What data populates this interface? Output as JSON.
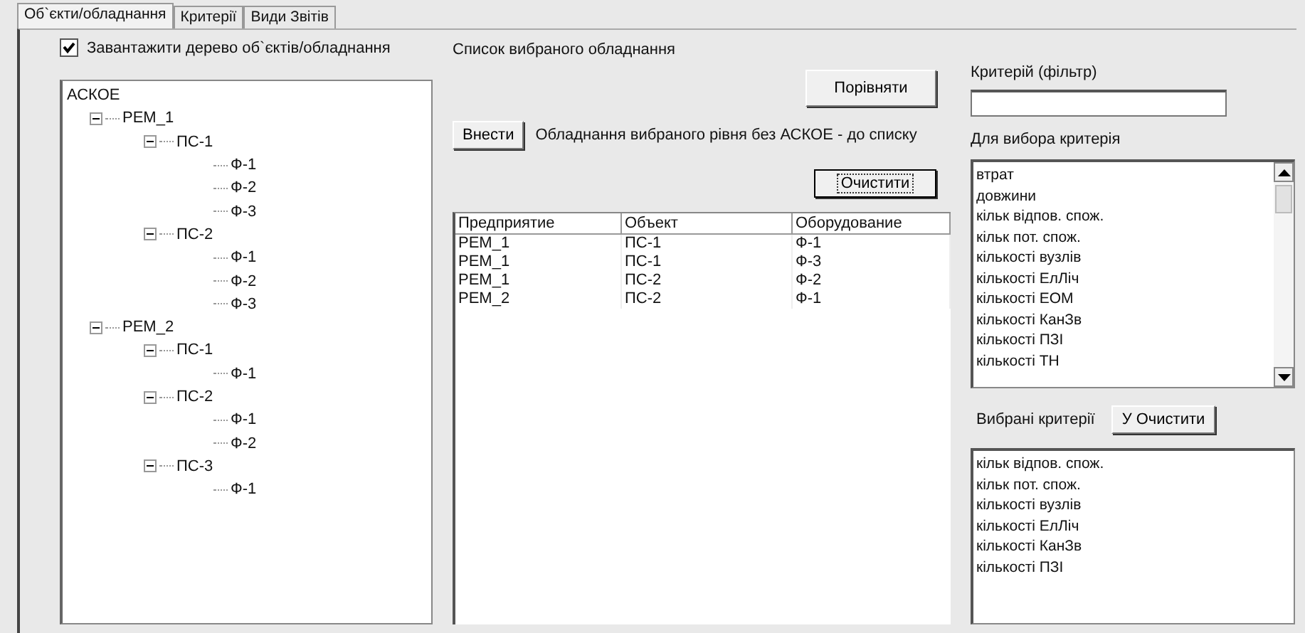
{
  "tabs": [
    {
      "label": "Об`єкти/обладнання",
      "selected": true
    },
    {
      "label": "Критерії",
      "selected": false
    },
    {
      "label": "Види Звітів",
      "selected": false
    }
  ],
  "load_tree": {
    "label": "Завантажити дерево об`єктів/обладнання",
    "checked": true
  },
  "tree": [
    {
      "label": "АСКОЕ",
      "children": [
        {
          "label": "РЕМ_1",
          "expanded": true,
          "children": [
            {
              "label": "ПС-1",
              "expanded": true,
              "children": [
                {
                  "label": "Ф-1"
                },
                {
                  "label": "Ф-2"
                },
                {
                  "label": "Ф-3"
                }
              ]
            },
            {
              "label": "ПС-2",
              "expanded": true,
              "children": [
                {
                  "label": "Ф-1"
                },
                {
                  "label": "Ф-2"
                },
                {
                  "label": "Ф-3"
                }
              ]
            }
          ]
        },
        {
          "label": "РЕМ_2",
          "expanded": true,
          "children": [
            {
              "label": "ПС-1",
              "expanded": true,
              "children": [
                {
                  "label": "Ф-1"
                }
              ]
            },
            {
              "label": "ПС-2",
              "expanded": true,
              "children": [
                {
                  "label": "Ф-1"
                },
                {
                  "label": "Ф-2"
                }
              ]
            },
            {
              "label": "ПС-3",
              "expanded": true,
              "children": [
                {
                  "label": "Ф-1"
                }
              ]
            }
          ]
        }
      ]
    }
  ],
  "selected_list_label": "Список вибраного обладнання",
  "compare_button": "Порівняти",
  "add_button": "Внести",
  "add_hint": "Обладнання вибраного рівня без АСКОЕ - до списку",
  "clear_button": "Очистити",
  "table": {
    "columns": [
      "Предприятие",
      "Объект",
      "Оборудование"
    ],
    "rows": [
      [
        "РЕМ_1",
        "ПС-1",
        "Ф-1"
      ],
      [
        "РЕМ_1",
        "ПС-1",
        "Ф-3"
      ],
      [
        "РЕМ_1",
        "ПС-2",
        "Ф-2"
      ],
      [
        "РЕМ_2",
        "ПС-2",
        "Ф-1"
      ]
    ]
  },
  "filter_label": "Критерій (фільтр)",
  "criteria_label": "Для вибора критерія",
  "criteria": [
    "втрат",
    "довжини",
    "кільк відпов. спож.",
    "кільк пот. спож.",
    "кількості вузлів",
    "кількості ЕлЛіч",
    "кількості ЕОМ",
    "кількості КанЗв",
    "кількості ПЗІ",
    "кількості ТН"
  ],
  "chosen_label": "Вибрані критерії",
  "chosen_clear_button": "У Очистити",
  "chosen": [
    "кільк відпов. спож.",
    "кільк пот. спож.",
    "кількості вузлів",
    "кількості ЕлЛіч",
    "кількості КанЗв",
    "кількості ПЗІ"
  ]
}
